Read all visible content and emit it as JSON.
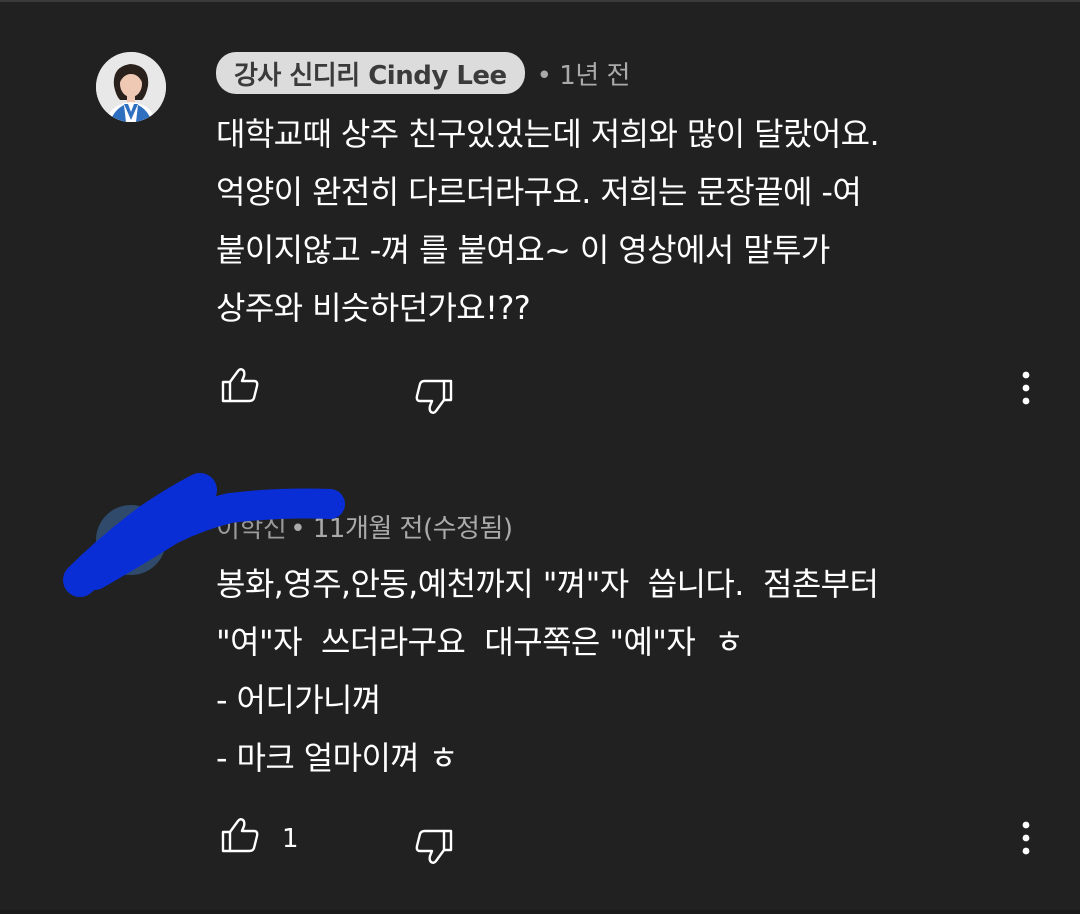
{
  "comments": [
    {
      "author": "강사 신디리 Cindy Lee",
      "meta": "• 1년 전",
      "lines": [
        "대학교때 상주 친구있었는데 저희와 많이 달랐어요.",
        "억양이 완전히 다르더라구요. 저희는 문장끝에 -여",
        "붙이지않고 -껴 를 붙여요~ 이 영상에서 말투가",
        "상주와 비슷하던가요!??"
      ],
      "likes": ""
    },
    {
      "author": "이학신",
      "meta": "• 11개월 전(수정됨)",
      "lines": [
        "봉화,영주,안동,예천까지 \"껴\"자  씁니다.  점촌부터",
        "\"여\"자  쓰더라구요  대구쪽은 \"예\"자  ㅎ",
        "- 어디가니껴",
        "- 마크 얼마이껴 ㅎ"
      ],
      "likes": "1"
    }
  ],
  "icons": {
    "like": "thumbs-up-icon",
    "dislike": "thumbs-down-icon",
    "more": "more-vertical-icon"
  },
  "colors": {
    "background": "#212121",
    "author_chip": "#dcdcdc",
    "meta": "#aaaaaa",
    "text": "#ffffff",
    "redaction": "#0a2ed6"
  }
}
